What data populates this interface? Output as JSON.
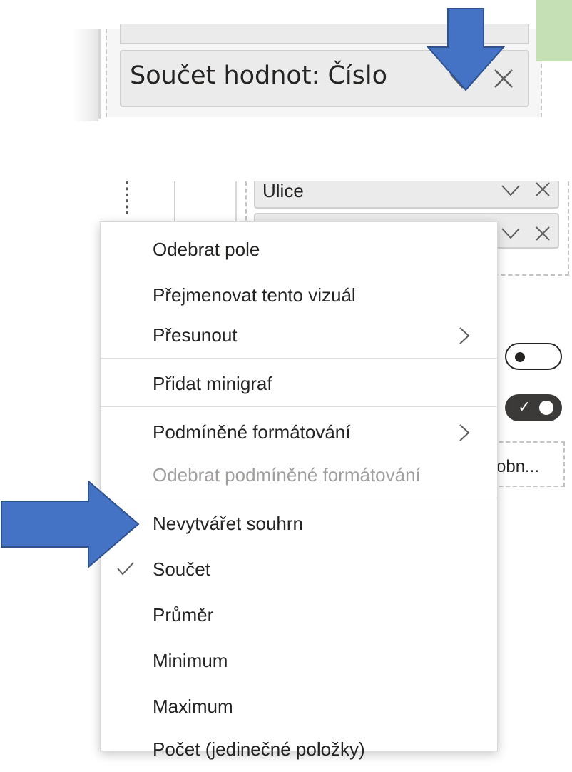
{
  "top_field": {
    "label": "Součet hodnot: Číslo"
  },
  "panel": {
    "ulice_label": "Ulice",
    "combo_text": "obn..."
  },
  "menu": {
    "items": [
      {
        "label": "Odebrat pole",
        "enabled": true
      },
      {
        "label": "Přejmenovat tento vizuál",
        "enabled": true
      },
      {
        "label": "Přesunout",
        "enabled": true,
        "submenu": true
      },
      {
        "label": "Přidat minigraf",
        "enabled": true
      },
      {
        "label": "Podmíněné formátování",
        "enabled": true,
        "submenu": true
      },
      {
        "label": "Odebrat podmíněné formátování",
        "enabled": false
      },
      {
        "label": "Nevytvářet souhrn",
        "enabled": true
      },
      {
        "label": "Součet",
        "enabled": true,
        "checked": true
      },
      {
        "label": "Průměr",
        "enabled": true
      },
      {
        "label": "Minimum",
        "enabled": true
      },
      {
        "label": "Maximum",
        "enabled": true
      },
      {
        "label": "Počet (jedinečné položky)",
        "enabled": true
      }
    ]
  },
  "colors": {
    "annotation_arrow": "#4472c4",
    "annotation_arrow_border": "#2f528f",
    "green_box": "#c5e0b4",
    "disabled_text": "#a19f9d"
  },
  "icons": [
    "chevron-down-icon",
    "close-icon",
    "chevron-right-icon",
    "checkmark-icon"
  ]
}
